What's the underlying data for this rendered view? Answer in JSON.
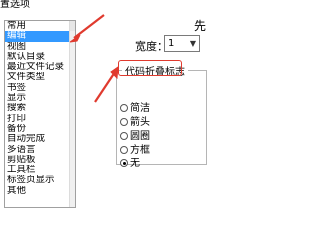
{
  "dialog": {
    "title": "置选项"
  },
  "list": {
    "items": [
      "常用",
      "编辑",
      "视图",
      "默认目录",
      "最近文件记录",
      "文件类型",
      "书签",
      "显示",
      "搜索",
      "打印",
      "备份",
      "自动完成",
      "多语言",
      "剪贴板",
      "工具栏",
      "标签页显示",
      "其他"
    ],
    "selected_index": 1
  },
  "width_setting": {
    "label": "宽度：",
    "value": "1"
  },
  "groupbox": {
    "title": "代码折叠标志"
  },
  "fold_marker_options": [
    {
      "label": "简洁",
      "checked": false
    },
    {
      "label": "箭头",
      "checked": false
    },
    {
      "label": "圆圈",
      "checked": false
    },
    {
      "label": "方框",
      "checked": false
    },
    {
      "label": "无",
      "checked": true
    }
  ],
  "edge_text": "先",
  "annotation_color": "#e03a2e"
}
